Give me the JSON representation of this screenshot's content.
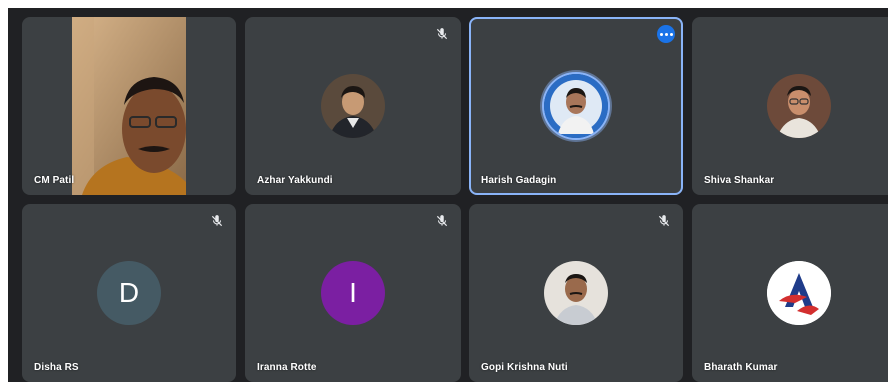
{
  "participants": [
    {
      "name": "CM Patil",
      "muted": false,
      "type": "video"
    },
    {
      "name": "Azhar Yakkundi",
      "muted": true,
      "type": "photo"
    },
    {
      "name": "Harish Gadagin",
      "muted": false,
      "type": "photo",
      "active": true
    },
    {
      "name": "Shiva Shankar",
      "muted": true,
      "type": "photo"
    },
    {
      "name": "Disha RS",
      "muted": true,
      "type": "letter",
      "letter": "D",
      "color": "#455a64"
    },
    {
      "name": "Iranna Rotte",
      "muted": true,
      "type": "letter",
      "letter": "I",
      "color": "#7b1fa2"
    },
    {
      "name": "Gopi Krishna Nuti",
      "muted": true,
      "type": "photo"
    },
    {
      "name": "Bharath Kumar",
      "muted": false,
      "type": "logo"
    }
  ],
  "icons": {
    "mic_off": "mic-off-icon",
    "more": "more-options-icon"
  },
  "colors": {
    "background": "#202124",
    "tile": "#3c4043",
    "active_border": "#8ab4f8",
    "more_button": "#1a73e8"
  }
}
